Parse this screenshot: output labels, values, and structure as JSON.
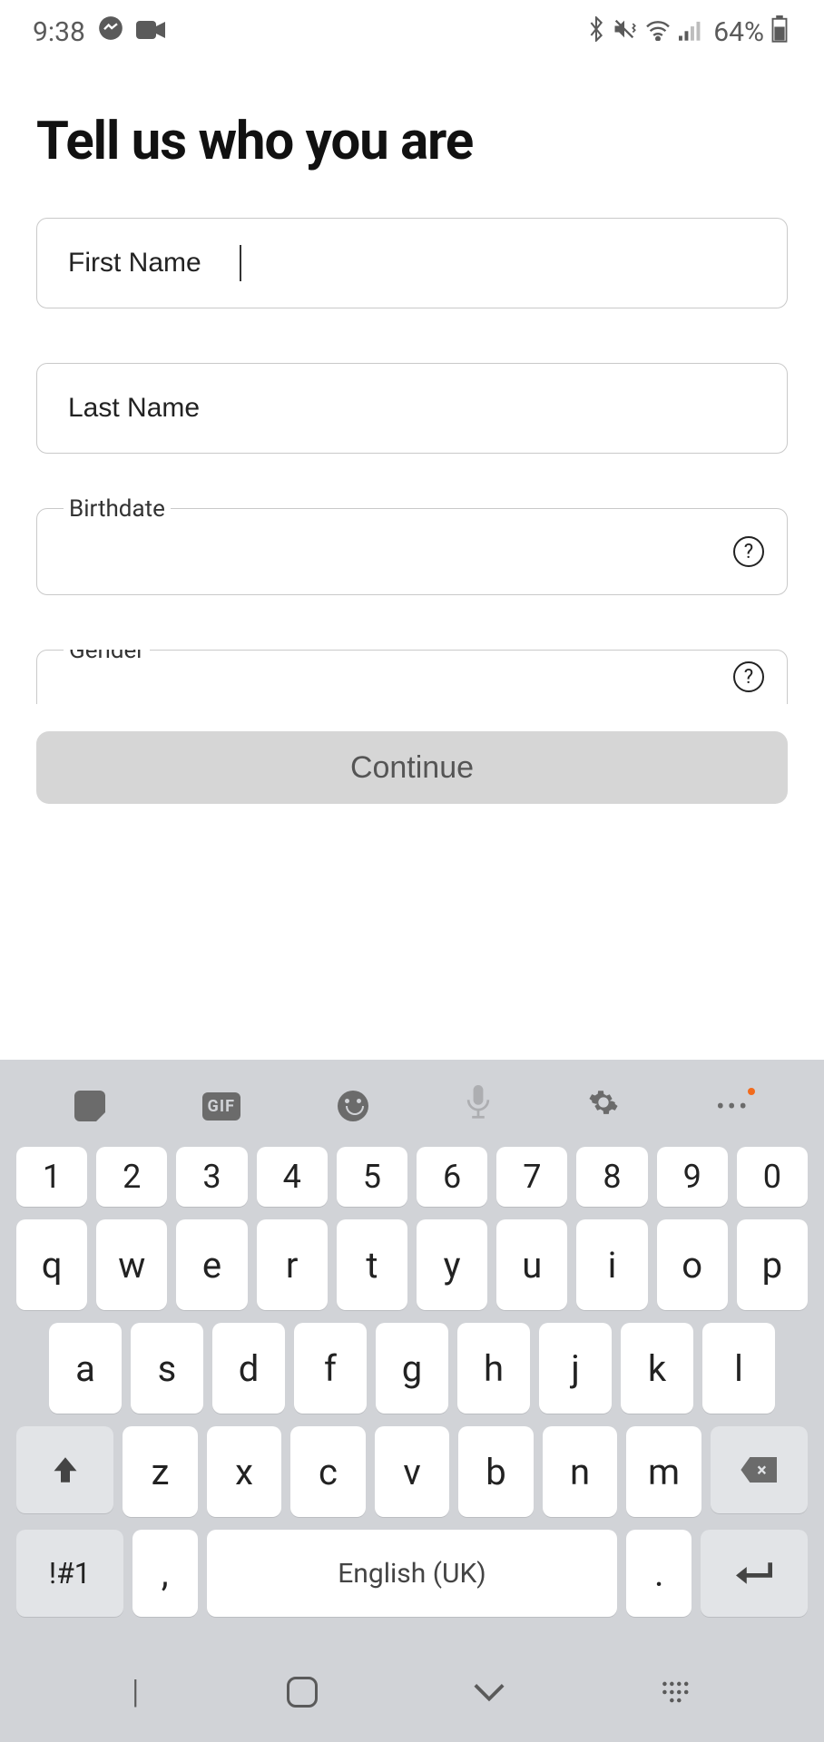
{
  "status": {
    "time": "9:38",
    "battery": "64%"
  },
  "page": {
    "title": "Tell us who you are",
    "continue": "Continue"
  },
  "fields": {
    "firstName": {
      "placeholder": "First Name",
      "value": ""
    },
    "lastName": {
      "placeholder": "Last Name",
      "value": ""
    },
    "birthdate": {
      "label": "Birthdate",
      "value": ""
    },
    "gender": {
      "label": "Gender",
      "value": ""
    }
  },
  "keyboard": {
    "toolbar": {
      "gif": "GIF"
    },
    "row_num": [
      "1",
      "2",
      "3",
      "4",
      "5",
      "6",
      "7",
      "8",
      "9",
      "0"
    ],
    "row1": [
      "q",
      "w",
      "e",
      "r",
      "t",
      "y",
      "u",
      "i",
      "o",
      "p"
    ],
    "row2": [
      "a",
      "s",
      "d",
      "f",
      "g",
      "h",
      "j",
      "k",
      "l"
    ],
    "row3": [
      "z",
      "x",
      "c",
      "v",
      "b",
      "n",
      "m"
    ],
    "sym": "!#1",
    "comma": ",",
    "space": "English (UK)",
    "period": "."
  }
}
